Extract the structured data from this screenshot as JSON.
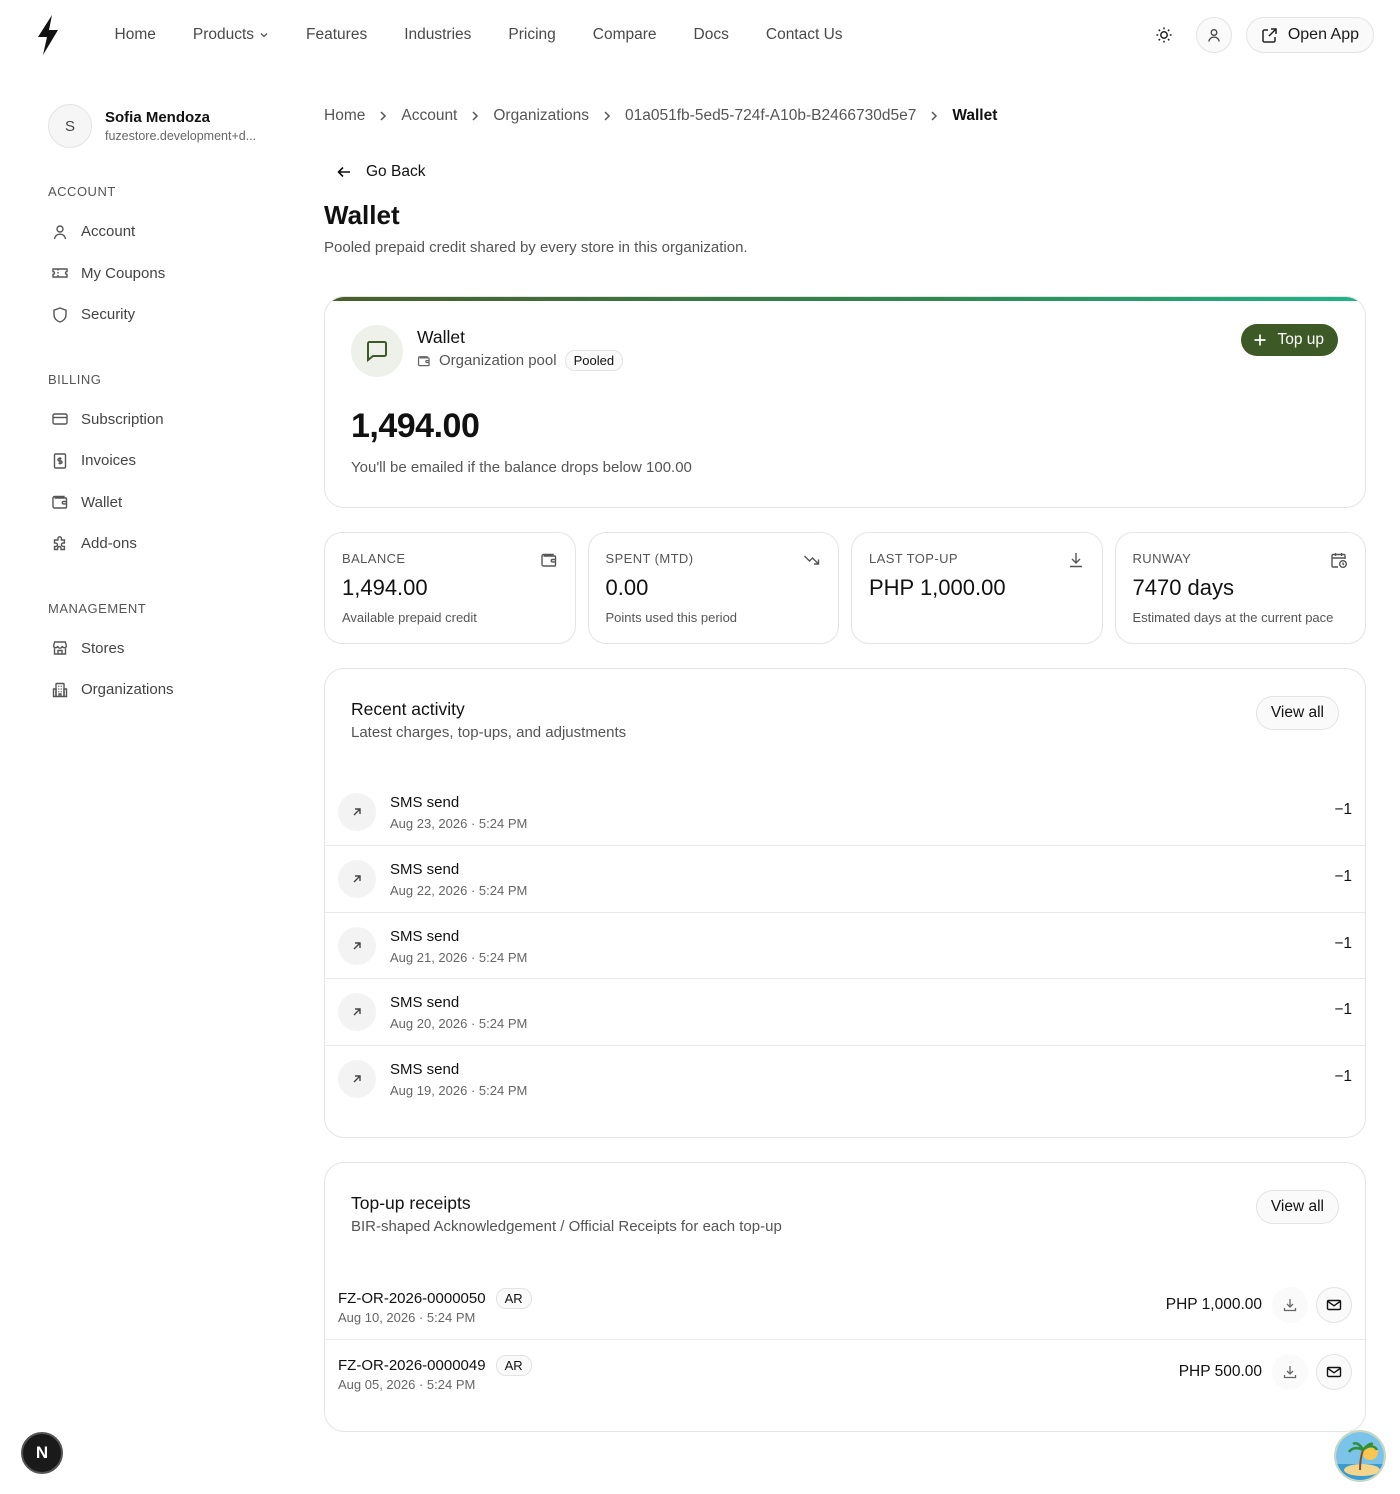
{
  "nav": {
    "links": [
      "Home",
      "Products",
      "Features",
      "Industries",
      "Pricing",
      "Compare",
      "Docs",
      "Contact Us"
    ],
    "open_app": "Open App"
  },
  "user": {
    "initial": "S",
    "name": "Sofia Mendoza",
    "email": "fuzestore.development+d..."
  },
  "sidebar": {
    "sections": [
      {
        "title": "ACCOUNT",
        "items": [
          {
            "label": "Account",
            "icon": "user-icon"
          },
          {
            "label": "My Coupons",
            "icon": "ticket-icon"
          },
          {
            "label": "Security",
            "icon": "shield-icon"
          }
        ]
      },
      {
        "title": "BILLING",
        "items": [
          {
            "label": "Subscription",
            "icon": "credit-card-icon"
          },
          {
            "label": "Invoices",
            "icon": "receipt-icon"
          },
          {
            "label": "Wallet",
            "icon": "wallet-icon"
          },
          {
            "label": "Add-ons",
            "icon": "puzzle-icon"
          }
        ]
      },
      {
        "title": "MANAGEMENT",
        "items": [
          {
            "label": "Stores",
            "icon": "store-icon"
          },
          {
            "label": "Organizations",
            "icon": "building-icon"
          }
        ]
      }
    ]
  },
  "breadcrumb": [
    "Home",
    "Account",
    "Organizations",
    "01a051fb-5ed5-724f-A10b-B2466730d5e7",
    "Wallet"
  ],
  "go_back": "Go Back",
  "page": {
    "title": "Wallet",
    "subtitle": "Pooled prepaid credit shared by every store in this organization."
  },
  "hero": {
    "title": "Wallet",
    "meta": "Organization pool",
    "badge": "Pooled",
    "topup": "Top up",
    "amount": "1,494.00",
    "note": "You'll be emailed if the balance drops below 100.00",
    "accent_from": "#4a5e2a",
    "accent_to": "#1fb48a",
    "button_color": "#3d5a26"
  },
  "stats": [
    {
      "label": "BALANCE",
      "value": "1,494.00",
      "note": "Available prepaid credit",
      "icon": "wallet-icon"
    },
    {
      "label": "SPENT (MTD)",
      "value": "0.00",
      "note": "Points used this period",
      "icon": "trending-down-icon"
    },
    {
      "label": "LAST TOP-UP",
      "value": "PHP 1,000.00",
      "note": "",
      "icon": "download-icon"
    },
    {
      "label": "RUNWAY",
      "value": "7470 days",
      "note": "Estimated days at the current pace",
      "icon": "calendar-clock-icon"
    }
  ],
  "activity": {
    "title": "Recent activity",
    "subtitle": "Latest charges, top-ups, and adjustments",
    "view_all": "View all",
    "rows": [
      {
        "title": "SMS send",
        "date": "Aug 23, 2026 · 5:24 PM",
        "amount": "−1"
      },
      {
        "title": "SMS send",
        "date": "Aug 22, 2026 · 5:24 PM",
        "amount": "−1"
      },
      {
        "title": "SMS send",
        "date": "Aug 21, 2026 · 5:24 PM",
        "amount": "−1"
      },
      {
        "title": "SMS send",
        "date": "Aug 20, 2026 · 5:24 PM",
        "amount": "−1"
      },
      {
        "title": "SMS send",
        "date": "Aug 19, 2026 · 5:24 PM",
        "amount": "−1"
      }
    ]
  },
  "receipts": {
    "title": "Top-up receipts",
    "subtitle": "BIR-shaped Acknowledgement / Official Receipts for each top-up",
    "view_all": "View all",
    "rows": [
      {
        "id": "FZ-OR-2026-0000050",
        "tag": "AR",
        "date": "Aug 10, 2026 · 5:24 PM",
        "amount": "PHP 1,000.00"
      },
      {
        "id": "FZ-OR-2026-0000049",
        "tag": "AR",
        "date": "Aug 05, 2026 · 5:24 PM",
        "amount": "PHP 500.00"
      }
    ]
  },
  "dev_badge": "N"
}
